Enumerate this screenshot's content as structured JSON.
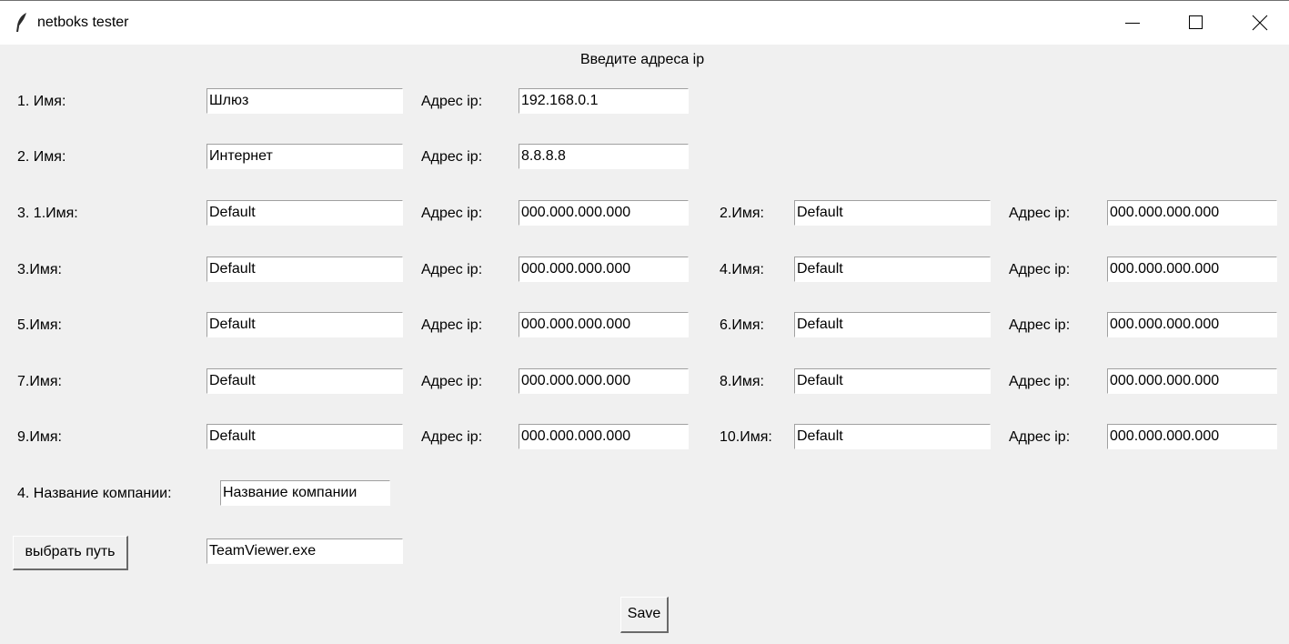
{
  "window": {
    "title": "netboks tester"
  },
  "header": "Введите адреса ip",
  "ip_label": "Адрес ip:",
  "rows": [
    {
      "label": "1. Имя:",
      "name": "Шлюз",
      "ip": "192.168.0.1"
    },
    {
      "label": "2. Имя:",
      "name": "Интернет",
      "ip": "8.8.8.8"
    }
  ],
  "grid_rows": [
    {
      "left": {
        "label": "3. 1.Имя:",
        "name": "Default",
        "ip": "000.000.000.000"
      },
      "right": {
        "label": "2.Имя:",
        "name": "Default",
        "ip": "000.000.000.000"
      }
    },
    {
      "left": {
        "label": "3.Имя:",
        "name": "Default",
        "ip": "000.000.000.000"
      },
      "right": {
        "label": "4.Имя:",
        "name": "Default",
        "ip": "000.000.000.000"
      }
    },
    {
      "left": {
        "label": "5.Имя:",
        "name": "Default",
        "ip": "000.000.000.000"
      },
      "right": {
        "label": "6.Имя:",
        "name": "Default",
        "ip": "000.000.000.000"
      }
    },
    {
      "left": {
        "label": "7.Имя:",
        "name": "Default",
        "ip": "000.000.000.000"
      },
      "right": {
        "label": "8.Имя:",
        "name": "Default",
        "ip": "000.000.000.000"
      }
    },
    {
      "left": {
        "label": "9.Имя:",
        "name": "Default",
        "ip": "000.000.000.000"
      },
      "right": {
        "label": "10.Имя:",
        "name": "Default",
        "ip": "000.000.000.000"
      }
    }
  ],
  "company": {
    "label": "4. Название компании:",
    "value": "Название компании"
  },
  "path": {
    "button_label": "выбрать путь",
    "value": "TeamViewer.exe"
  },
  "save_label": "Save"
}
